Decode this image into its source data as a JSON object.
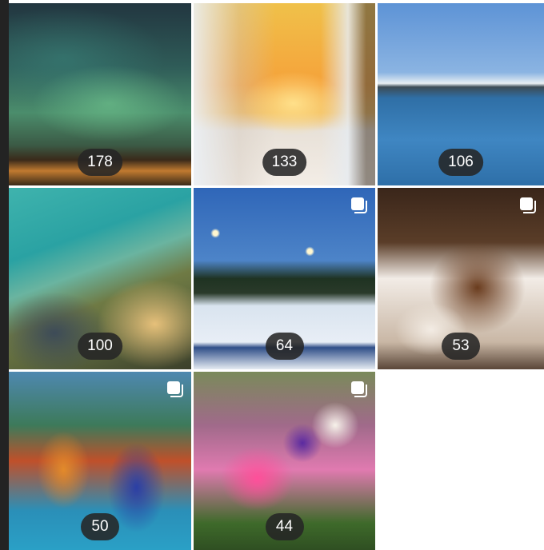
{
  "grid": {
    "tiles": [
      {
        "count": "178",
        "icon": "aurora-photo",
        "multi": false
      },
      {
        "count": "133",
        "icon": "winter-forest-photo",
        "multi": false
      },
      {
        "count": "106",
        "icon": "lighthouse-sea-photo",
        "multi": false
      },
      {
        "count": "100",
        "icon": "coastal-cliff-photo",
        "multi": false
      },
      {
        "count": "64",
        "icon": "ice-rink-photo",
        "multi": true
      },
      {
        "count": "53",
        "icon": "food-plate-photo",
        "multi": true
      },
      {
        "count": "50",
        "icon": "mascot-toys-photo",
        "multi": true
      },
      {
        "count": "44",
        "icon": "flower-bouquet-photo",
        "multi": true
      }
    ]
  },
  "colors": {
    "badge_bg": "#262626",
    "badge_text": "#ffffff",
    "left_strip": "#232323"
  }
}
